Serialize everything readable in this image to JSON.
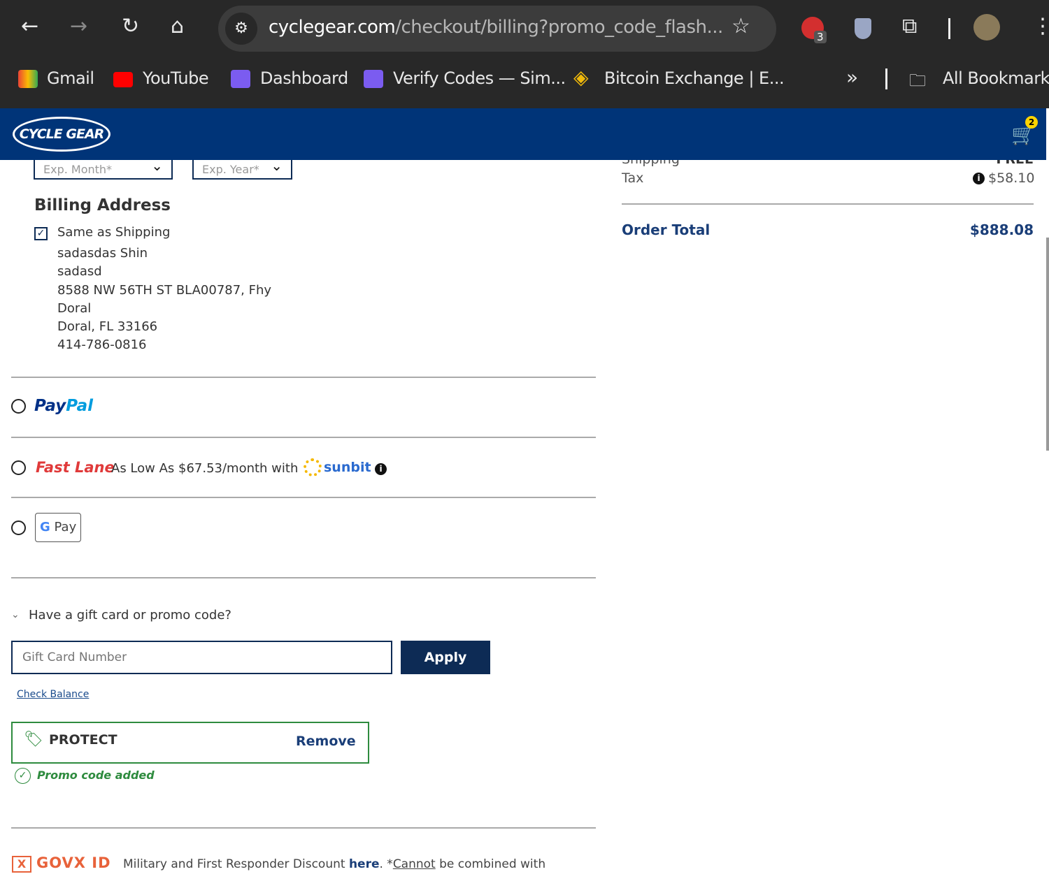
{
  "browser": {
    "url_host": "cyclegear.com",
    "url_path": "/checkout/billing?promo_code_flash...",
    "extension_badge": "3",
    "bookmarks": [
      {
        "label": "Gmail",
        "icon": "gmail-icon"
      },
      {
        "label": "YouTube",
        "icon": "youtube-icon"
      },
      {
        "label": "Dashboard",
        "icon": "bookmark-purple-icon"
      },
      {
        "label": "Verify Codes — Sim...",
        "icon": "bookmark-purple-icon"
      },
      {
        "label": "Bitcoin Exchange | E...",
        "icon": "binance-icon"
      }
    ],
    "more": "»",
    "all_bookmarks": "All Bookmarks"
  },
  "site": {
    "logo": "CYCLE GEAR",
    "cart_count": "2",
    "brand_color": "#003478"
  },
  "form": {
    "exp_month": "Exp. Month*",
    "exp_year": "Exp. Year*"
  },
  "billing": {
    "title": "Billing Address",
    "same_as_shipping": "Same as Shipping",
    "same_checked": true,
    "lines": [
      "sadasdas Shin",
      "sadasd",
      "8588 NW 56TH ST BLA00787, Fhy",
      "Doral",
      "Doral, FL 33166",
      "414-786-0816"
    ]
  },
  "payment": {
    "paypal_a": "Pay",
    "paypal_b": "Pal",
    "fastlane": "Fast Lane",
    "fastlane_text": "As Low As $67.53/month with",
    "sunbit": "sunbit",
    "gpay": "Pay"
  },
  "promo": {
    "toggle": "Have a gift card or promo code?",
    "placeholder": "Gift Card Number",
    "apply": "Apply",
    "check_balance": "Check Balance",
    "code": "PROTECT",
    "remove": "Remove",
    "added": "Promo code added"
  },
  "govx": {
    "logo": "GOVX ID",
    "text": "Military and First Responder Discount ",
    "here": "here",
    "after": ". *",
    "cannot": "Cannot",
    "rest": " be combined with"
  },
  "summary": {
    "shipping_label": "Shipping",
    "shipping_value": "FREE",
    "tax_label": "Tax",
    "tax_value": "$58.10",
    "total_label": "Order Total",
    "total_value": "$888.08"
  }
}
